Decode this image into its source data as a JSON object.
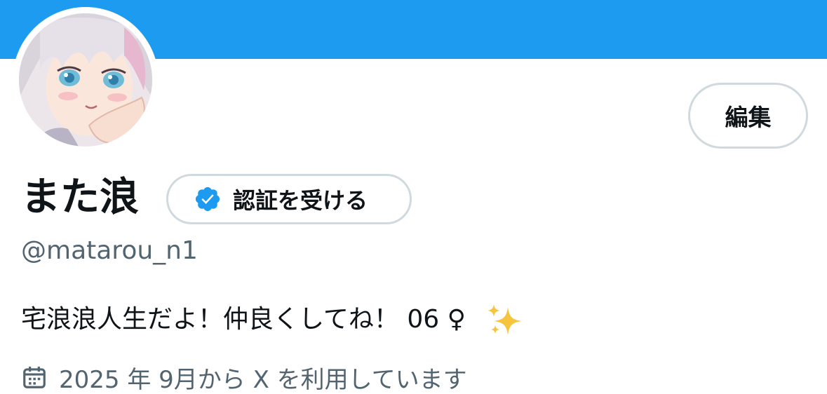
{
  "colors": {
    "banner": "#1d9bf0",
    "verified_blue": "#1d9bf0",
    "border_gray": "#cfd9de",
    "secondary_text": "#536471",
    "primary_text": "#0f1419"
  },
  "profile": {
    "display_name": "また浪",
    "handle": "@matarou_n1",
    "bio": "宅浪浪人生だよ！仲良くしてね！ 06 ♀",
    "bio_emoji": "sparkles",
    "joined": "2025 年 9月から X を利用しています"
  },
  "buttons": {
    "edit_label": "編集",
    "verify_label": "認証を受ける"
  },
  "icons": {
    "verified": "verified-badge-icon",
    "calendar": "calendar-icon",
    "sparkles": "sparkles-emoji"
  }
}
